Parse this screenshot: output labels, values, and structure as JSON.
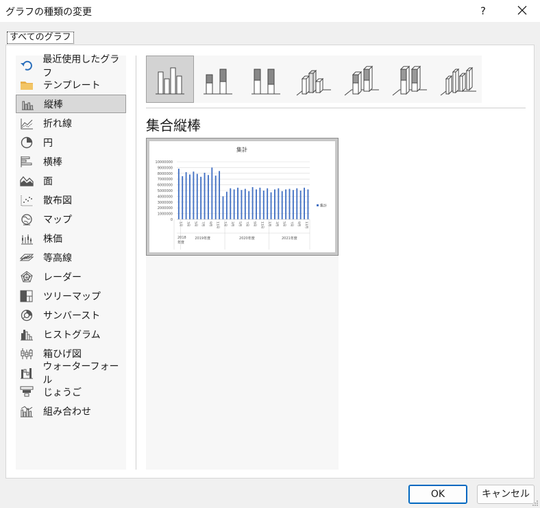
{
  "window": {
    "title": "グラフの種類の変更",
    "help_label": "?"
  },
  "tab": {
    "label": "すべてのグラフ"
  },
  "sidebar": {
    "items": [
      {
        "label": "最近使用したグラフ",
        "icon": "recent-icon"
      },
      {
        "label": "テンプレート",
        "icon": "folder-icon"
      },
      {
        "label": "縦棒",
        "icon": "column-chart-icon",
        "selected": true
      },
      {
        "label": "折れ線",
        "icon": "line-chart-icon"
      },
      {
        "label": "円",
        "icon": "pie-chart-icon"
      },
      {
        "label": "横棒",
        "icon": "bar-chart-icon"
      },
      {
        "label": "面",
        "icon": "area-chart-icon"
      },
      {
        "label": "散布図",
        "icon": "scatter-chart-icon"
      },
      {
        "label": "マップ",
        "icon": "map-icon"
      },
      {
        "label": "株価",
        "icon": "stock-chart-icon"
      },
      {
        "label": "等高線",
        "icon": "surface-chart-icon"
      },
      {
        "label": "レーダー",
        "icon": "radar-chart-icon"
      },
      {
        "label": "ツリーマップ",
        "icon": "treemap-icon"
      },
      {
        "label": "サンバースト",
        "icon": "sunburst-icon"
      },
      {
        "label": "ヒストグラム",
        "icon": "histogram-icon"
      },
      {
        "label": "箱ひげ図",
        "icon": "box-whisker-icon"
      },
      {
        "label": "ウォーターフォール",
        "icon": "waterfall-icon"
      },
      {
        "label": "じょうご",
        "icon": "funnel-icon"
      },
      {
        "label": "組み合わせ",
        "icon": "combo-chart-icon"
      }
    ]
  },
  "subtypes": {
    "selected_title": "集合縦棒",
    "items": [
      {
        "name": "clustered-column",
        "selected": true
      },
      {
        "name": "stacked-column"
      },
      {
        "name": "100-stacked-column"
      },
      {
        "name": "3d-clustered-column"
      },
      {
        "name": "3d-stacked-column"
      },
      {
        "name": "3d-100-stacked-column"
      },
      {
        "name": "3d-column"
      }
    ]
  },
  "preview": {
    "chart_data": {
      "type": "bar",
      "title": "集計",
      "series": [
        {
          "name": "集計",
          "values": [
            8800000,
            7500000,
            8200000,
            7800000,
            8300000,
            7900000,
            7400000,
            8100000,
            7700000,
            9000000,
            7600000,
            8400000,
            4000000,
            4800000,
            5400000,
            5200000,
            5500000,
            5100000,
            5300000,
            4900000,
            5600000,
            5200000,
            5500000,
            5000000,
            5400000,
            4700000,
            5200000,
            5400000,
            4900000,
            5200000,
            5300000,
            5100000,
            5400000,
            5000000,
            5500000,
            5200000
          ]
        }
      ],
      "ylim": [
        0,
        10000000
      ],
      "yticks": [
        "10000000",
        "9000000",
        "8000000",
        "7000000",
        "6000000",
        "5000000",
        "4000000",
        "3000000",
        "2000000",
        "1000000",
        "0"
      ],
      "xtick_labels": [
        "1月",
        "3月",
        "5月",
        "7月",
        "9月",
        "11月",
        "1月",
        "3月",
        "5月",
        "7月",
        "9月",
        "11月",
        "1月",
        "3月",
        "5月",
        "7月",
        "9月",
        "11月"
      ],
      "groups": [
        {
          "label": "2018年度"
        },
        {
          "label": "2019年度"
        },
        {
          "label": "2020年度"
        },
        {
          "label": "2021年度"
        }
      ],
      "legend_position": "right",
      "grid": true,
      "bar_color": "#4472c4"
    }
  },
  "buttons": {
    "ok_label": "OK",
    "cancel_label": "キャンセル"
  }
}
